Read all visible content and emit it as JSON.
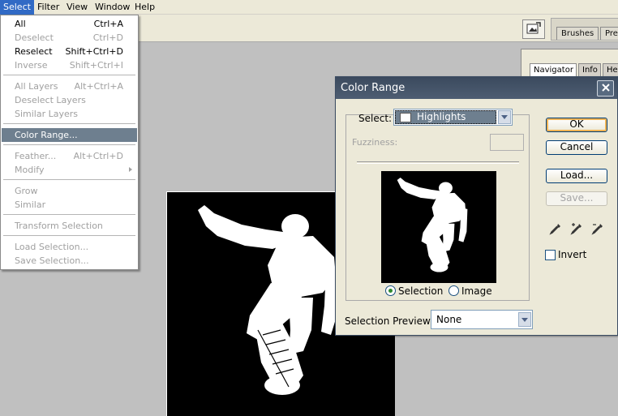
{
  "menubar": {
    "items": [
      "Select",
      "Filter",
      "View",
      "Window",
      "Help"
    ],
    "active": "Select"
  },
  "palette_well": {
    "tabs": [
      "Brushes",
      "Pre"
    ]
  },
  "navigator_panel": {
    "tabs": [
      "Navigator",
      "Info",
      "He"
    ]
  },
  "select_menu": {
    "items": [
      {
        "label": "All",
        "shortcut": "Ctrl+A",
        "enabled": true
      },
      {
        "label": "Deselect",
        "shortcut": "Ctrl+D",
        "enabled": false
      },
      {
        "label": "Reselect",
        "shortcut": "Shift+Ctrl+D",
        "enabled": true
      },
      {
        "label": "Inverse",
        "shortcut": "Shift+Ctrl+I",
        "enabled": false
      },
      {
        "label": "All Layers",
        "shortcut": "Alt+Ctrl+A",
        "enabled": false
      },
      {
        "label": "Deselect Layers",
        "shortcut": "",
        "enabled": false
      },
      {
        "label": "Similar Layers",
        "shortcut": "",
        "enabled": false
      },
      {
        "label": "Color Range...",
        "shortcut": "",
        "enabled": true,
        "highlighted": true
      },
      {
        "label": "Feather...",
        "shortcut": "Alt+Ctrl+D",
        "enabled": false
      },
      {
        "label": "Modify",
        "shortcut": "",
        "enabled": false,
        "submenu": true
      },
      {
        "label": "Grow",
        "shortcut": "",
        "enabled": false
      },
      {
        "label": "Similar",
        "shortcut": "",
        "enabled": false
      },
      {
        "label": "Transform Selection",
        "shortcut": "",
        "enabled": false
      },
      {
        "label": "Load Selection...",
        "shortcut": "",
        "enabled": false
      },
      {
        "label": "Save Selection...",
        "shortcut": "",
        "enabled": false
      }
    ]
  },
  "dialog": {
    "title": "Color Range",
    "select_label": "Select:",
    "select_value": "Highlights",
    "fuzziness_label": "Fuzziness:",
    "fuzziness_value": "",
    "radio_selection": "Selection",
    "radio_image": "Image",
    "radio_checked": "Selection",
    "selection_preview_label": "Selection Preview:",
    "selection_preview_value": "None",
    "buttons": {
      "ok": "OK",
      "cancel": "Cancel",
      "load": "Load...",
      "save": "Save..."
    },
    "invert_label": "Invert",
    "invert_checked": false,
    "eyedroppers": [
      "eyedropper-icon",
      "eyedropper-plus-icon",
      "eyedropper-minus-icon"
    ]
  },
  "colors": {
    "menu_highlight": "#6e7f8f",
    "titlebar": "#3b4a5e",
    "workspace": "#c0c0c0"
  }
}
